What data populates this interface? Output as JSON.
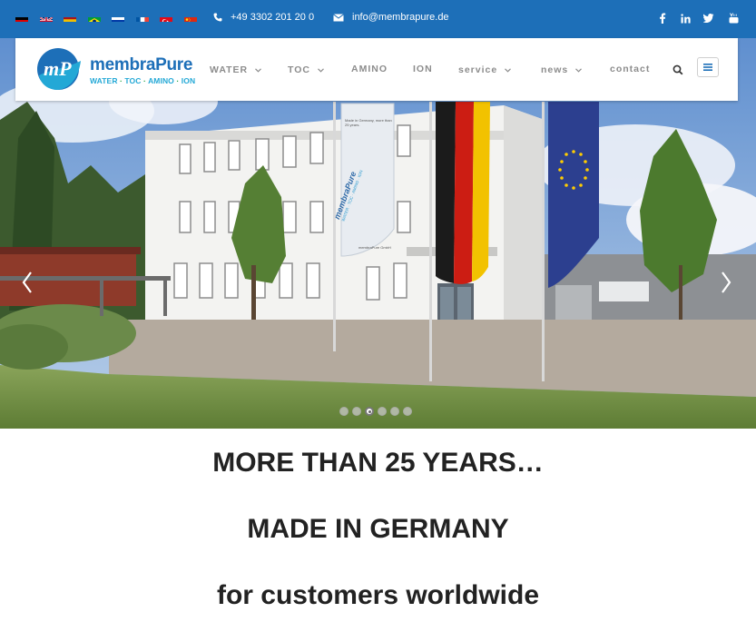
{
  "topbar": {
    "bg_color": "#1d6fb8",
    "languages": [
      {
        "code": "de",
        "name": "German"
      },
      {
        "code": "en",
        "name": "English"
      },
      {
        "code": "es",
        "name": "Spanish"
      },
      {
        "code": "br",
        "name": "Portuguese (Brazil)"
      },
      {
        "code": "ru",
        "name": "Russian"
      },
      {
        "code": "fr",
        "name": "French"
      },
      {
        "code": "tr",
        "name": "Turkish"
      },
      {
        "code": "cn",
        "name": "Chinese"
      }
    ],
    "phone": "+49 3302 201 20 0",
    "email": "info@membrapure.de",
    "social": [
      "facebook-icon",
      "linkedin-icon",
      "twitter-icon",
      "youtube-icon"
    ]
  },
  "logo": {
    "brand": "membraPure",
    "tag_water": "WATER",
    "tag_toc": "TOC",
    "tag_amino": "AMINO",
    "tag_ion": "ION",
    "tag_sep": " · ",
    "brand_color": "#1d6fb8"
  },
  "nav": {
    "items": [
      {
        "label": "WATER",
        "has_dropdown": true
      },
      {
        "label": "TOC",
        "has_dropdown": true
      },
      {
        "label": "AMINO",
        "has_dropdown": false
      },
      {
        "label": "ION",
        "has_dropdown": false
      },
      {
        "label": "service",
        "has_dropdown": true
      },
      {
        "label": "news",
        "has_dropdown": true
      },
      {
        "label": "contact",
        "has_dropdown": false
      }
    ],
    "search_icon": "search-icon",
    "menu_icon": "hamburger-icon"
  },
  "hero": {
    "slide_count": 6,
    "active_slide": 3,
    "banner_brand": "membraPure",
    "banner_tag": "WATER · TOC · AMINO · ION",
    "banner_small": "Made in Germany, more than 25 years.",
    "doorplate": "membraPure GmbH"
  },
  "content": {
    "heading1": "MORE THAN 25 YEARS…",
    "heading2": "MADE IN GERMANY",
    "heading3": "for customers worldwide"
  }
}
